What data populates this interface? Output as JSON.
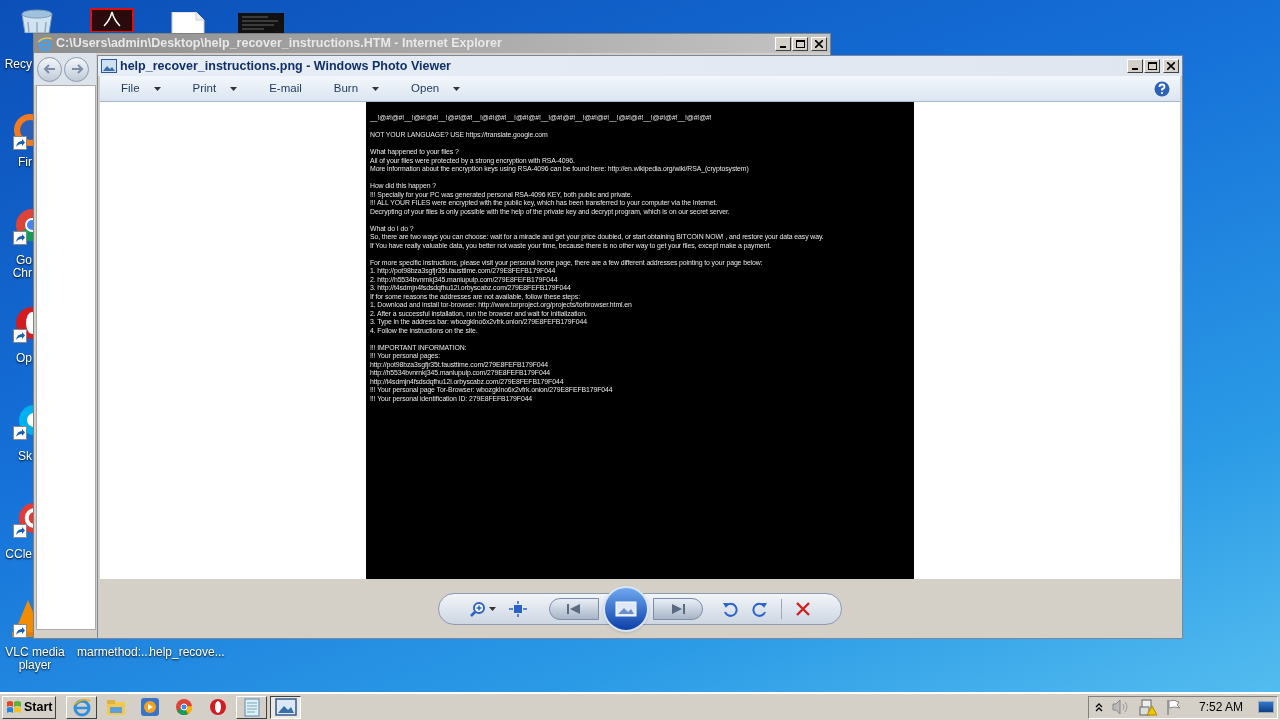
{
  "desktop_icons": [
    {
      "kind": "recycle-bin",
      "label": [
        "Recy"
      ]
    },
    {
      "kind": "pdf"
    },
    {
      "kind": "document"
    },
    {
      "kind": "image"
    },
    {
      "kind": "firefox",
      "label": [
        "Fir"
      ]
    },
    {
      "kind": "chrome",
      "label": [
        "Go",
        "Chr"
      ]
    },
    {
      "kind": "opera",
      "label": [
        "Op"
      ]
    },
    {
      "kind": "skype",
      "label": [
        "Sk"
      ]
    },
    {
      "kind": "ccleaner",
      "label": [
        "CCle"
      ]
    },
    {
      "kind": "vlc",
      "label": [
        "VLC media",
        "player"
      ]
    },
    {
      "kind": "hidden",
      "label": [
        "marmethod:..."
      ]
    },
    {
      "kind": "hidden",
      "label": [
        "help_recove..."
      ]
    }
  ],
  "browser_window": {
    "title": "C:\\Users\\admin\\Desktop\\help_recover_instructions.HTM - Internet Explorer"
  },
  "viewer_window": {
    "title": "help_recover_instructions.png - Windows Photo Viewer",
    "menu": [
      {
        "label": "File",
        "dropdown": true
      },
      {
        "label": "Print",
        "dropdown": true
      },
      {
        "label": "E-mail",
        "dropdown": false
      },
      {
        "label": "Burn",
        "dropdown": true
      },
      {
        "label": "Open",
        "dropdown": true
      }
    ],
    "note": [
      [
        "__!@#!@#!__!@#!@#!__!@#!@#!__!@#!@#!__!@#!@#!__!@#!@#!__!@#!@#!__!@#!@#!__!@#!@#!__!@#!@#!"
      ],
      [
        "NOT YOUR LANGUAGE? USE https://translate.google.com"
      ],
      [
        "What happened to your files ?",
        "All of your files were protected by a strong encryption with RSA-4096.",
        "More information about the encryption keys using RSA-4096 can be found here: http://en.wikipedia.org/wiki/RSA_(cryptosystem)"
      ],
      [
        "How did this happen ?",
        "!!! Specially for your PC was generated personal RSA-4096 KEY, both public and private.",
        "!!! ALL YOUR FILES were encrypted with the public key, which has been transferred to your computer via the Internet.",
        "Decrypting of your files is only possible with the help of the private key and decrypt program, which is on our secret server."
      ],
      [
        "What do I do ?",
        "So, there are two ways you can choose: wait for a miracle and get your price doubled, or start obtaining BITCOIN NOW! , and restore your data easy way.",
        "If You have really valuable data, you better not waste your time, because there is no other way to get your files, except make a payment."
      ],
      [
        "For more specific instructions, please visit your personal home page, there are a few different addresses pointing to your page below:",
        "1. http://pot98bza3sgfjr35t.fausttime.com/279E8FEFB179F044",
        "2. http://h5534bvnrnkj345.maniupulp.com/279E8FEFB179F044",
        "3. http://t4sdmjn4fsdsdqfhu12l.orbyscabz.com/279E8FEFB179F044",
        "If for some reasons the addresses are not available, follow these steps:",
        "1. Download and install tor-browser: http://www.torproject.org/projects/torbrowser.html.en",
        "2. After a successful installation, run the browser and wait for initialization.",
        "3. Type in the address bar: wbozgklno6x2vfrk.onion/279E8FEFB179F044",
        "4. Follow the instructions on the site."
      ],
      [
        "!!! IMPORTANT INFORMATION:",
        "!!! Your personal pages:",
        "http://pot98bza3sgfjr35t.fausttime.com/279E8FEFB179F044",
        "http://h5534bvnrnkj345.maniupulp.com/279E8FEFB179F044",
        "http://t4sdmjn4fsdsdqfhu12l.orbyscabz.com/279E8FEFB179F044",
        "!!! Your personal page Tor-Browser: wbozgklno6x2vfrk.onion/279E8FEFB179F044",
        "!!! Your personal identification ID: 279E8FEFB179F044"
      ]
    ],
    "controls": [
      {
        "kind": "zoom"
      },
      {
        "kind": "actual-size"
      },
      {
        "kind": "previous"
      },
      {
        "kind": "slideshow"
      },
      {
        "kind": "next"
      },
      {
        "kind": "rotate-left"
      },
      {
        "kind": "rotate-right"
      },
      {
        "kind": "delete"
      }
    ]
  },
  "taskbar": {
    "start": "Start",
    "apps": [
      {
        "kind": "ie",
        "selected": false
      },
      {
        "kind": "explorer",
        "selected": false
      },
      {
        "kind": "media",
        "selected": false
      },
      {
        "kind": "chrome",
        "selected": false
      },
      {
        "kind": "opera",
        "selected": false
      },
      {
        "kind": "notepad",
        "selected": false
      },
      {
        "kind": "photo",
        "selected": true
      }
    ],
    "clock": "7:52 AM"
  }
}
